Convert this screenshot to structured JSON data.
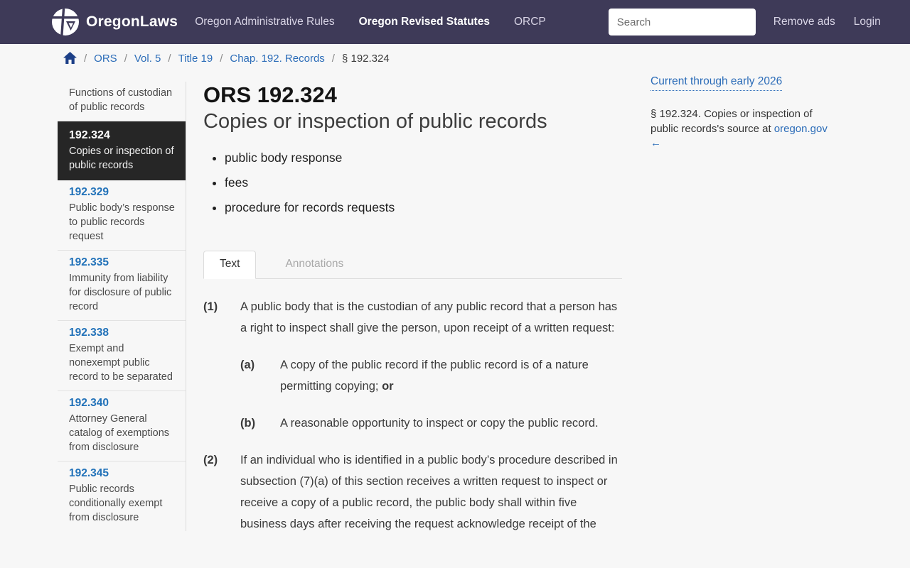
{
  "header": {
    "brand": "OregonLaws",
    "nav": [
      {
        "label": "Oregon Administrative Rules",
        "active": false
      },
      {
        "label": "Oregon Revised Statutes",
        "active": true
      },
      {
        "label": "ORCP",
        "active": false
      }
    ],
    "search_placeholder": "Search",
    "remove_ads_label": "Remove ads",
    "login_label": "Login"
  },
  "breadcrumb": {
    "links": [
      "ORS",
      "Vol. 5",
      "Title 19",
      "Chap. 192. Records"
    ],
    "current": "§ 192.324"
  },
  "sidebar": {
    "items": [
      {
        "number": "",
        "title": "Functions of custodian of public records",
        "active": false
      },
      {
        "number": "192.324",
        "title": "Copies or inspection of public records",
        "active": true
      },
      {
        "number": "192.329",
        "title": "Public body’s response to public records request",
        "active": false
      },
      {
        "number": "192.335",
        "title": "Immunity from liability for disclosure of public record",
        "active": false
      },
      {
        "number": "192.338",
        "title": "Exempt and nonexempt public record to be separated",
        "active": false
      },
      {
        "number": "192.340",
        "title": "Attorney General catalog of exemptions from disclosure",
        "active": false
      },
      {
        "number": "192.345",
        "title": "Public records conditionally exempt from disclosure",
        "active": false
      }
    ]
  },
  "main": {
    "heading": "ORS 192.324",
    "subtitle": "Copies or inspection of public records",
    "bullets": [
      "public body response",
      "fees",
      "procedure for records requests"
    ],
    "tabs": {
      "text": "Text",
      "annotations": "Annotations"
    },
    "statute": [
      {
        "num": "(1)",
        "text": "A public body that is the custodian of any public record that a person has a right to inspect shall give the person, upon receipt of a written request:",
        "bold_suffix": ""
      },
      {
        "num": "(a)",
        "text": "A copy of the public record if the public record is of a nature permitting copying; ",
        "bold_suffix": "or"
      },
      {
        "num": "(b)",
        "text": "A reasonable opportunity to inspect or copy the public record.",
        "bold_suffix": ""
      },
      {
        "num": "(2)",
        "text": "If an individual who is identified in a public body’s procedure described in subsection (7)(a) of this section receives a written request to inspect or receive a copy of a public record, the public body shall within five business days after receiving the request acknowledge receipt of the",
        "bold_suffix": ""
      }
    ]
  },
  "rightrail": {
    "current_through": "Current through early 2026",
    "source_prefix": "§ 192.324. Copies or inspection of public records's source at ",
    "source_link": "oregon.gov ←"
  },
  "colors": {
    "header_bg": "#3e3a58",
    "link_blue": "#2b6cb8",
    "sidebar_number_blue": "#2272b9",
    "active_item_bg": "#262626",
    "page_bg": "#f7f7f7",
    "home_icon_navy": "#1c3f87"
  }
}
